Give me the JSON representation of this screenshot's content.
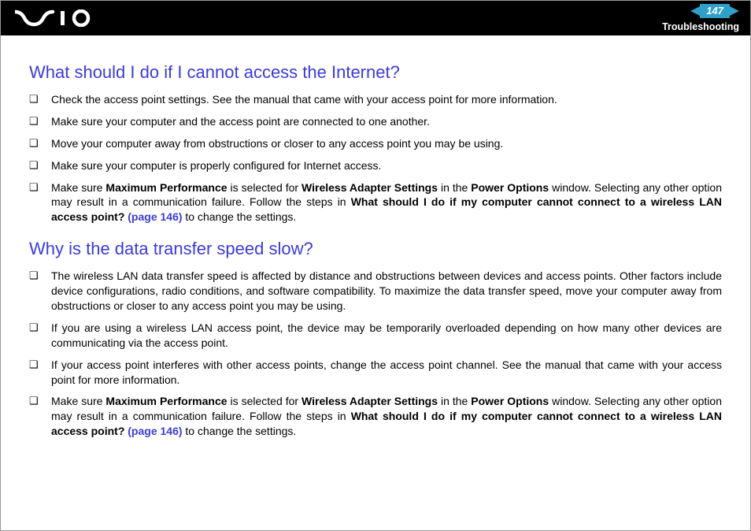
{
  "header": {
    "page_number": "147",
    "section": "Troubleshooting"
  },
  "section1": {
    "heading": "What should I do if I cannot access the Internet?",
    "items": {
      "i0": "Check the access point settings. See the manual that came with your access point for more information.",
      "i1": "Make sure your computer and the access point are connected to one another.",
      "i2": "Move your computer away from obstructions or closer to any access point you may be using.",
      "i3": "Make sure your computer is properly configured for Internet access."
    },
    "item4": {
      "p1": "Make sure ",
      "b1": "Maximum Performance",
      "p2": " is selected for ",
      "b2": "Wireless Adapter Settings",
      "p3": " in the ",
      "b3": "Power Options",
      "p4": " window. Selecting any other option may result in a communication failure. Follow the steps in ",
      "b4": "What should I do if my computer cannot connect to a wireless LAN access point? ",
      "link": "(page 146)",
      "p5": " to change the settings."
    }
  },
  "section2": {
    "heading": "Why is the data transfer speed slow?",
    "items": {
      "i0": "The wireless LAN data transfer speed is affected by distance and obstructions between devices and access points. Other factors include device configurations, radio conditions, and software compatibility. To maximize the data transfer speed, move your computer away from obstructions or closer to any access point you may be using.",
      "i1": "If you are using a wireless LAN access point, the device may be temporarily overloaded depending on how many other devices are communicating via the access point.",
      "i2": "If your access point interferes with other access points, change the access point channel. See the manual that came with your access point for more information."
    },
    "item3": {
      "p1": "Make sure ",
      "b1": "Maximum Performance",
      "p2": " is selected for ",
      "b2": "Wireless Adapter Settings",
      "p3": " in the ",
      "b3": "Power Options",
      "p4": " window. Selecting any other option may result in a communication failure. Follow the steps in ",
      "b4": "What should I do if my computer cannot connect to a wireless LAN access point? ",
      "link": "(page 146)",
      "p5": " to change the settings."
    }
  }
}
